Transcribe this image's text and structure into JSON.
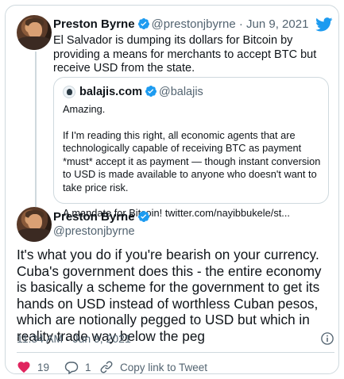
{
  "tweet": {
    "author_name": "Preston Byrne",
    "author_handle": "@prestonjbyrne",
    "separator": "·",
    "date": "Jun 9, 2021",
    "text": "El Salvador is dumping its dollars for Bitcoin by providing a means for merchants to accept BTC but receive USD from the state."
  },
  "quoted": {
    "author_name": "balajis.com",
    "author_handle": "@balajis",
    "paragraphs": [
      "Amazing.",
      "If I'm reading this right, all economic agents that are technologically capable of receiving BTC as payment *must* accept it as payment — though instant conversion to USD is made available to anyone who doesn't want to take price risk.",
      "A mandate for Bitcoin! twitter.com/nayibbukele/st..."
    ]
  },
  "reply": {
    "author_name": "Preston Byrne",
    "author_handle": "@prestonjbyrne",
    "text": "It's what you do if you're bearish on your currency. Cuba's government does this - the entire economy is basically a scheme for the government to get its hands on USD instead of worthless Cuban pesos, which are notionally pegged to USD but which in reality trade way below the peg",
    "timestamp": "11:34 AM · Jun 9, 2021"
  },
  "actions": {
    "likes": "19",
    "replies": "1",
    "copy_link": "Copy link to Tweet"
  },
  "colors": {
    "twitter_blue": "#1d9bf0",
    "like_red": "#e0245e",
    "muted": "#536471",
    "border": "#cfd9de"
  },
  "icons": {
    "brand": "twitter-bird-icon",
    "verified": "verified-badge-icon",
    "like": "heart-icon",
    "reply": "reply-bubble-icon",
    "copy": "link-icon",
    "info": "info-icon"
  }
}
